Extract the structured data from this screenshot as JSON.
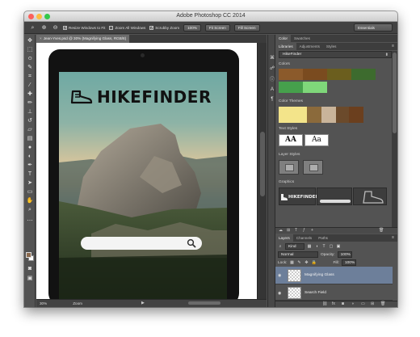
{
  "app": {
    "title": "Adobe Photoshop CC 2014"
  },
  "options_bar": {
    "resize_windows": "Resize Windows to Fit",
    "zoom_all_windows": "Zoom All Windows",
    "scrubby_zoom": "Scrubby Zoom",
    "btn_100": "100%",
    "btn_fit": "Fit Screen",
    "btn_fill": "Fill Screen",
    "workspace": "Essentials"
  },
  "document": {
    "tab": "Jean-Yves.psd @ 30% (Magnifying Glass, RGB/8)",
    "logo_text": "HIKEFINDER",
    "zoom_status": "30%",
    "status_label": "Zoom"
  },
  "panels": {
    "top_tabs": [
      "Color",
      "Swatches"
    ],
    "lib_tabs": [
      "Libraries",
      "Adjustments",
      "Styles"
    ],
    "library_name": "HikeFinder",
    "sections": {
      "colors": "Colors",
      "color_themes": "Color Themes",
      "text_styles": "Text Styles",
      "layer_styles": "Layer Styles",
      "graphics": "Graphics"
    },
    "text_style_samples": [
      "AA",
      "Aa"
    ],
    "graphic_logo": "HIKEFINDER"
  },
  "library_colors": [
    "#8b5a2b",
    "#7a4b1f",
    "#6b5e1e",
    "#3d6b2e",
    "#46a04c",
    "#7fd77a"
  ],
  "theme_colors": [
    "#f3e48a",
    "#8b6a3b",
    "#c9b49a",
    "#6b4a2b",
    "#6b3f1e"
  ],
  "layers_panel": {
    "tabs": [
      "Layers",
      "Channels",
      "Paths"
    ],
    "kind": "Kind",
    "blend_mode": "Normal",
    "opacity_label": "Opacity:",
    "opacity_value": "100%",
    "lock_label": "Lock:",
    "fill_label": "Fill:",
    "fill_value": "100%",
    "layers": [
      "Magnifying Glass",
      "Search Field"
    ]
  }
}
